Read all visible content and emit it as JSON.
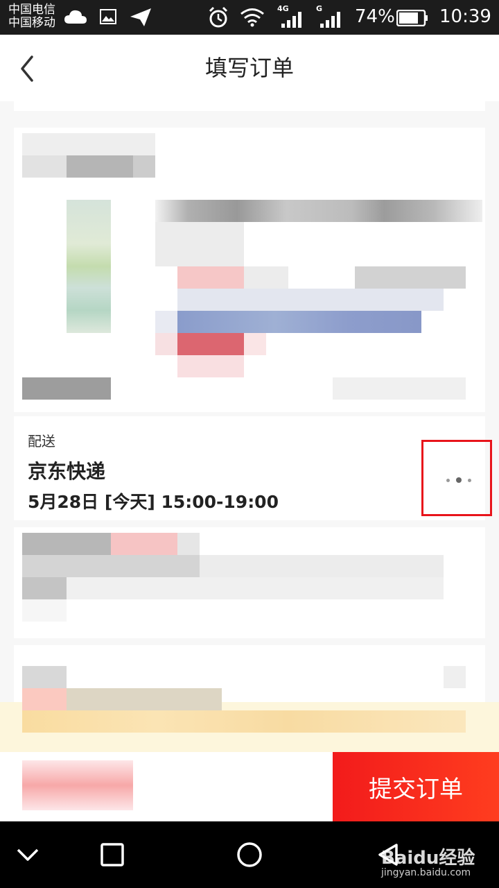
{
  "status_bar": {
    "carrier_1": "中国电信",
    "carrier_2": "中国移动",
    "network_1": "4G",
    "network_2": "G",
    "battery": "74%",
    "time": "10:39",
    "icons": [
      "cloud-icon",
      "image-icon",
      "send-icon",
      "alarm-icon",
      "wifi-icon",
      "signal-icon",
      "battery-icon"
    ]
  },
  "header": {
    "title": "填写订单",
    "back_icon": "chevron-left-icon"
  },
  "delivery": {
    "label": "配送",
    "company": "京东快递",
    "time": "5月28日 [今天] 15:00-19:00",
    "more_icon": "more-dots-icon",
    "highlight_color": "#e8141b"
  },
  "bottom_bar": {
    "submit_label": "提交订单",
    "submit_color": "#f21b1b"
  },
  "nav_bar": {
    "icons": [
      "nav-down-icon",
      "nav-recent-icon",
      "nav-home-icon",
      "nav-back-icon"
    ]
  },
  "watermark": {
    "brand": "Baidu经验",
    "url": "jingyan.baidu.com"
  }
}
